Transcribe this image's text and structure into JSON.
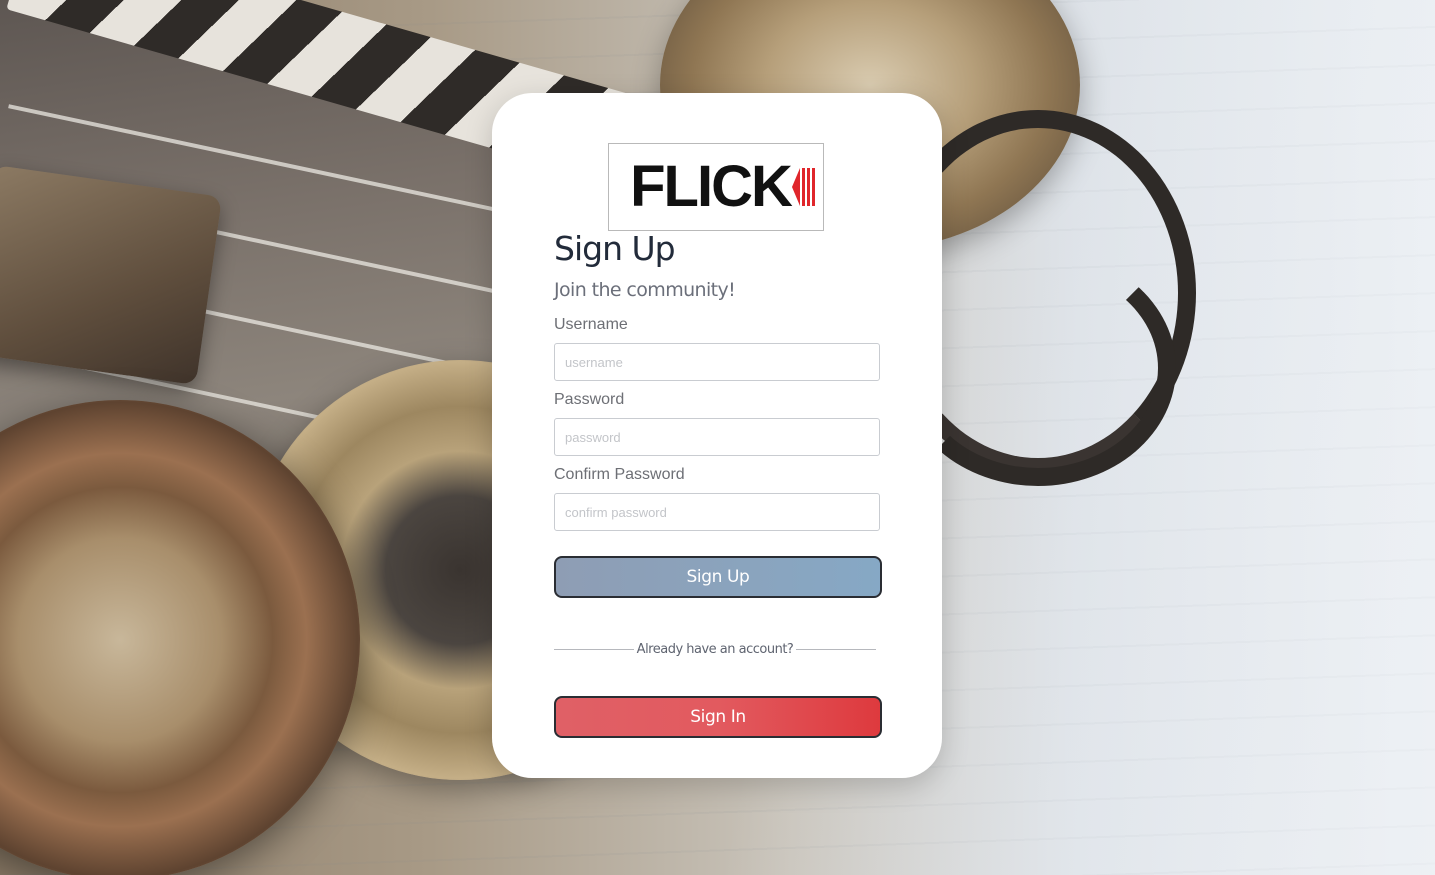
{
  "brand": {
    "name": "FLICK",
    "accent_color": "#e0262b"
  },
  "form": {
    "title": "Sign Up",
    "subtitle": "Join the community!",
    "fields": {
      "username": {
        "label": "Username",
        "placeholder": "username"
      },
      "password": {
        "label": "Password",
        "placeholder": "password"
      },
      "confirm_password": {
        "label": "Confirm Password",
        "placeholder": "confirm password"
      }
    },
    "signup_button": "Sign Up",
    "divider_text": "Already have an account?",
    "signin_button": "Sign In"
  },
  "colors": {
    "signup_button": "#8aa4be",
    "signin_button": "#e25a5f",
    "title": "#222b3a"
  }
}
